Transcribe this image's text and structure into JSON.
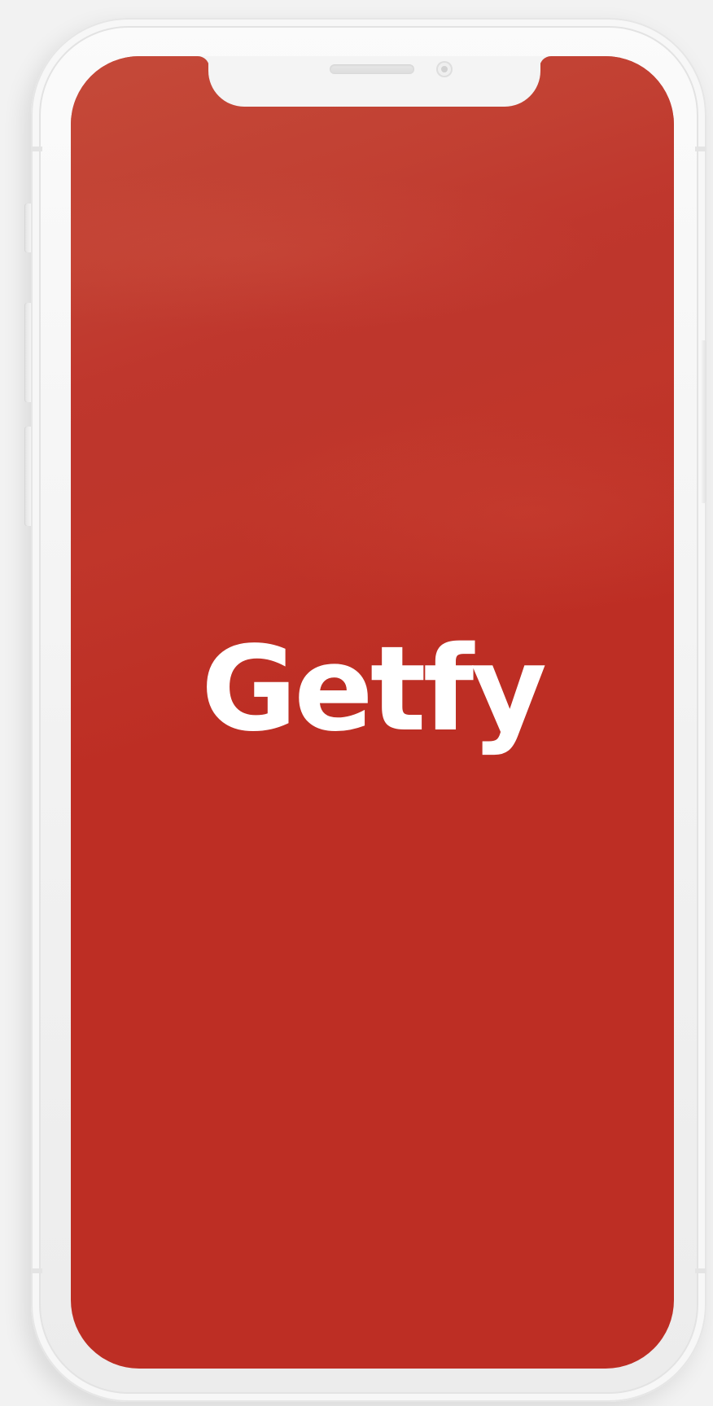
{
  "splash": {
    "app_name": "Getfy"
  },
  "colors": {
    "screen_background": "#bd2e24",
    "screen_highlight": "#c54b3a",
    "title_text": "#ffffff",
    "device_frame": "#f4f4f4"
  }
}
